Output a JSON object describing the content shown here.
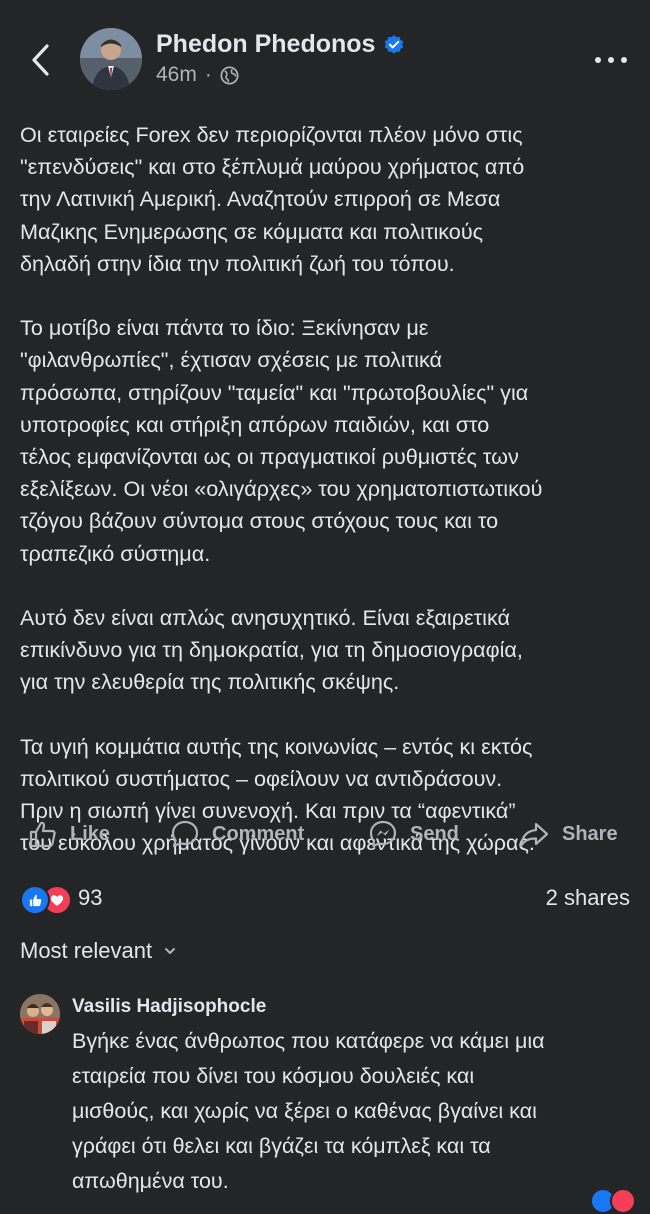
{
  "header": {
    "author": "Phedon Phedonos",
    "time": "46m",
    "separator": "·",
    "icons": {
      "back": "back-chevron-icon",
      "verified": "verified-badge-icon",
      "audience": "globe-icon",
      "more": "more-horizontal-icon"
    }
  },
  "post": {
    "paragraphs": [
      "Οι εταιρείες Forex δεν περιορίζονται πλέον μόνο στις\n\"επενδύσεις\" και στο ξέπλυμά μαύρου χρήματος από\nτην Λατινική Αμερική.  Αναζητούν επιρροή σε Μεσα\nΜαζικης Ενημερωσης σε κόμματα και πολιτικούς\nδηλαδή  στην ίδια την πολιτική ζωή του τόπου.",
      "Το μοτίβο είναι πάντα το ίδιο: Ξεκίνησαν με\n\"φιλανθρωπίες\", έχτισαν σχέσεις με πολιτικά\nπρόσωπα, στηρίζουν \"ταμεία\" και \"πρωτοβουλίες\" για\nυποτροφίες και στήριξη απόρων παιδιών, και στο\nτέλος εμφανίζονται ως οι πραγματικοί ρυθμιστές των\nεξελίξεων. Οι νέοι «ολιγάρχες» του χρηματοπιστωτικού\nτζόγου βάζουν σύντομα στους στόχους τους και το\nτραπεζικό σύστημα.",
      "Αυτό δεν είναι απλώς ανησυχητικό. Είναι εξαιρετικά\nεπικίνδυνο για τη δημοκρατία, για τη δημοσιογραφία,\nγια την ελευθερία της πολιτικής σκέψης.",
      "Τα υγιή κομμάτια αυτής της κοινωνίας – εντός κι εκτός\nπολιτικού συστήματος – οφείλουν να αντιδράσουν.\nΠριν η σιωπή γίνει συνενοχή. Και πριν τα “αφεντικά”\nτου εύκολου χρήματος γίνουν και αφεντικά της χώρας."
    ]
  },
  "actions": {
    "like": "Like",
    "comment": "Comment",
    "send": "Send",
    "share": "Share"
  },
  "reactions": {
    "count": "93",
    "shares": "2 shares",
    "icons": [
      "like-reaction-icon",
      "love-reaction-icon"
    ]
  },
  "comments": {
    "sort_label": "Most relevant",
    "items": [
      {
        "author": "Vasilis Hadjisophocle",
        "text": "Βγήκε ένας άνθρωπος που κατάφερε να κάμει μια\nεταιρεία που δίνει του κόσμου δουλειές και\nμισθούς, και χωρίς να ξέρει ο καθένας βγαίνει και\nγράφει ότι θελει και βγάζει τα κόμπλεξ και τα\nαπωθημένα του."
      }
    ]
  },
  "colors": {
    "background": "#242526",
    "text_primary": "#e4e6eb",
    "text_secondary": "#b0b3b8",
    "verified_blue": "#1877f2",
    "love_red": "#f33e58"
  }
}
